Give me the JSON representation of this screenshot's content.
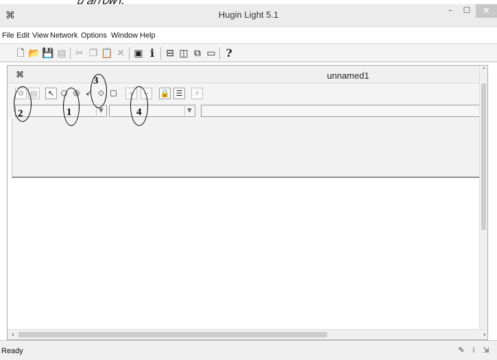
{
  "window": {
    "title": "Hugin Light 5.1",
    "app_icon": "network-nodes-icon"
  },
  "menubar": {
    "items": [
      "File",
      "Edit",
      "View",
      "Network",
      "Options",
      "Window",
      "Help"
    ]
  },
  "toolbar": {
    "icons": [
      "new-file-icon",
      "open-folder-icon",
      "save-icon",
      "print-preview-icon",
      "cut-icon",
      "copy-icon",
      "paste-icon",
      "delete-icon",
      "properties-icon",
      "info-icon",
      "layout-horizontal-icon",
      "layout-vertical-icon",
      "layout-cascade-icon",
      "layout-single-icon",
      "help-icon"
    ],
    "info_glyph": "i",
    "help_glyph": "?"
  },
  "document": {
    "title": "unnamed1",
    "toolbar_icons": [
      "compile-icon",
      "edit-mode-icon",
      "select-arrow-icon",
      "chance-node-icon",
      "decision-node-icon",
      "link-arrow-icon",
      "utility-node-icon",
      "function-node-icon",
      "add-state-icon",
      "remove-state-icon",
      "lock-icon",
      "table-icon",
      "lightning-icon"
    ]
  },
  "annotations": [
    {
      "number": "1",
      "target": "chance-node-tool"
    },
    {
      "number": "2",
      "target": "compile-tool"
    },
    {
      "number": "3",
      "target": "link-tool"
    },
    {
      "number": "4",
      "target": "add-remove-state-tools"
    }
  ],
  "statusbar": {
    "text": "Ready"
  },
  "colors": {
    "titlebar": "#ececec",
    "close_button": "#c8c8c8",
    "workspace": "#ffffff",
    "panel": "#f2f2f2"
  }
}
